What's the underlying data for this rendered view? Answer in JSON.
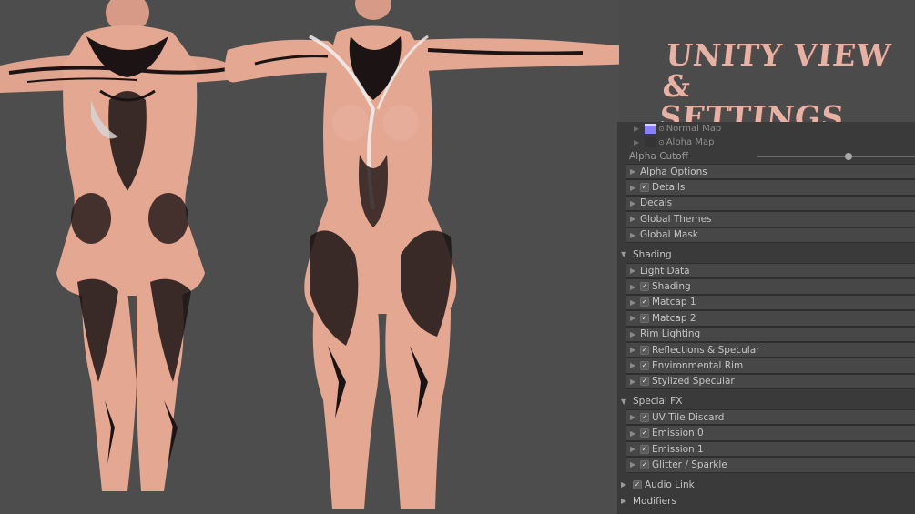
{
  "title": {
    "line1": "Unity View &",
    "line2": "Settings"
  },
  "textures": [
    {
      "label": "Normal Map",
      "swatch": "blue",
      "dot": "⊙"
    },
    {
      "label": "Alpha Map",
      "swatch": "empty",
      "dot": "⊙"
    }
  ],
  "alpha_cutoff": {
    "label": "Alpha Cutoff",
    "value": 0.58
  },
  "base_items": [
    {
      "label": "Alpha Options",
      "checked": false
    },
    {
      "label": "Details",
      "checked": true
    },
    {
      "label": "Decals",
      "checked": false
    },
    {
      "label": "Global Themes",
      "checked": false
    },
    {
      "label": "Global Mask",
      "checked": false
    }
  ],
  "sections": {
    "shading": {
      "label": "Shading",
      "items": [
        {
          "label": "Light Data",
          "checked": false
        },
        {
          "label": "Shading",
          "checked": true
        },
        {
          "label": "Matcap 1",
          "checked": true
        },
        {
          "label": "Matcap 2",
          "checked": true
        },
        {
          "label": "Rim Lighting",
          "checked": false
        },
        {
          "label": "Reflections & Specular",
          "checked": true
        },
        {
          "label": "Environmental Rim",
          "checked": true
        },
        {
          "label": "Stylized Specular",
          "checked": true
        }
      ]
    },
    "special_fx": {
      "label": "Special FX",
      "items": [
        {
          "label": "UV Tile Discard",
          "checked": true
        },
        {
          "label": "Emission 0",
          "checked": true
        },
        {
          "label": "Emission 1",
          "checked": true
        },
        {
          "label": "Glitter / Sparkle",
          "checked": true
        }
      ]
    },
    "audio_link": {
      "label": "Audio Link",
      "checked": true
    },
    "modifiers": {
      "label": "Modifiers"
    }
  },
  "icons": {
    "check": "✓",
    "arrow_right": "▶",
    "arrow_down": "▼"
  },
  "colors": {
    "skin": "#e3a792",
    "tattoo": "#1c1414",
    "title": "#e7b2a6",
    "panel": "#3a3a3a",
    "subrow": "#474747"
  }
}
